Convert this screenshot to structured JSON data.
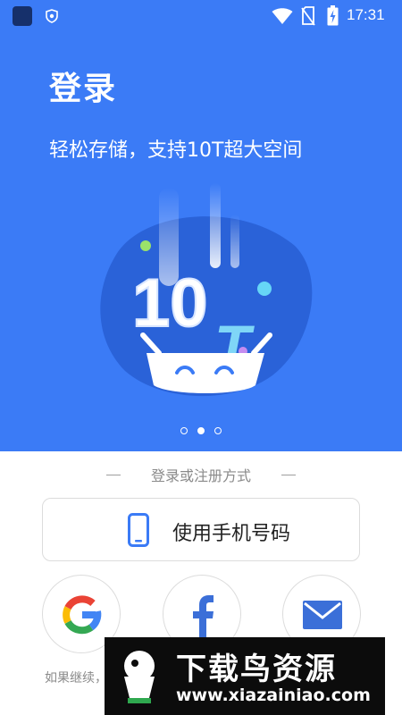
{
  "status_bar": {
    "time": "17:31",
    "icons": [
      "app-icon",
      "shield-icon",
      "wifi-icon",
      "no-sim-icon",
      "battery-charging-icon"
    ]
  },
  "hero": {
    "title": "登录",
    "subtitle": "轻松存储，支持10T超大空间",
    "background_color": "#3b7bf6",
    "illustration": {
      "text_number": "10",
      "text_letter": "T"
    },
    "pager": {
      "count": 3,
      "active_index": 1
    }
  },
  "login": {
    "divider_text": "登录或注册方式",
    "phone_button_label": "使用手机号码",
    "social_buttons": [
      {
        "name": "google",
        "icon": "google-icon"
      },
      {
        "name": "facebook",
        "icon": "facebook-icon"
      },
      {
        "name": "email",
        "icon": "mail-icon"
      }
    ],
    "footer_text": "如果继续，"
  },
  "watermark": {
    "title": "下载鸟资源",
    "url": "www.xiazainiao.com"
  },
  "colors": {
    "accent": "#3b7bf6",
    "border": "#dcdcdc",
    "muted_text": "#8a8a8a"
  }
}
